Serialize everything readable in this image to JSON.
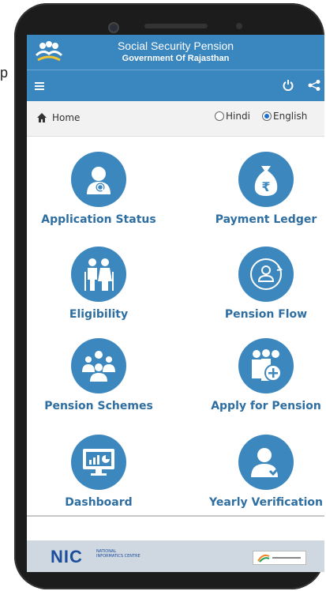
{
  "side_text": "p",
  "header": {
    "title": "Social Security Pension",
    "subtitle": "Government Of Rajasthan",
    "logo_icon": "people-hands-logo"
  },
  "toolbar": {
    "menu_icon": "hamburger-menu-icon",
    "power_icon": "power-icon",
    "share_icon": "share-icon"
  },
  "breadcrumb": {
    "home_label": "Home",
    "lang_options": [
      {
        "label": "Hindi",
        "selected": false
      },
      {
        "label": "English",
        "selected": true
      }
    ]
  },
  "tiles": [
    {
      "label": "Application Status",
      "icon": "user-search-icon"
    },
    {
      "label": "Payment Ledger",
      "icon": "rupee-bag-icon"
    },
    {
      "label": "Eligibility",
      "icon": "elderly-couple-icon"
    },
    {
      "label": "Pension Flow",
      "icon": "user-cycle-icon"
    },
    {
      "label": "Pension Schemes",
      "icon": "group-icon"
    },
    {
      "label": "Apply for Pension",
      "icon": "add-user-icon"
    },
    {
      "label": "Dashboard",
      "icon": "monitor-chart-icon"
    },
    {
      "label": "Yearly Verification",
      "icon": "user-check-icon"
    }
  ],
  "footer": {
    "nic_logo": "NIC",
    "nic_sub": "NATIONAL INFORMATICS CENTRE",
    "partner_logo": "digital-india-logo"
  },
  "colors": {
    "primary": "#3a86bf",
    "tile_label": "#2e6ea1",
    "footer_bg": "#cfd7e1"
  }
}
